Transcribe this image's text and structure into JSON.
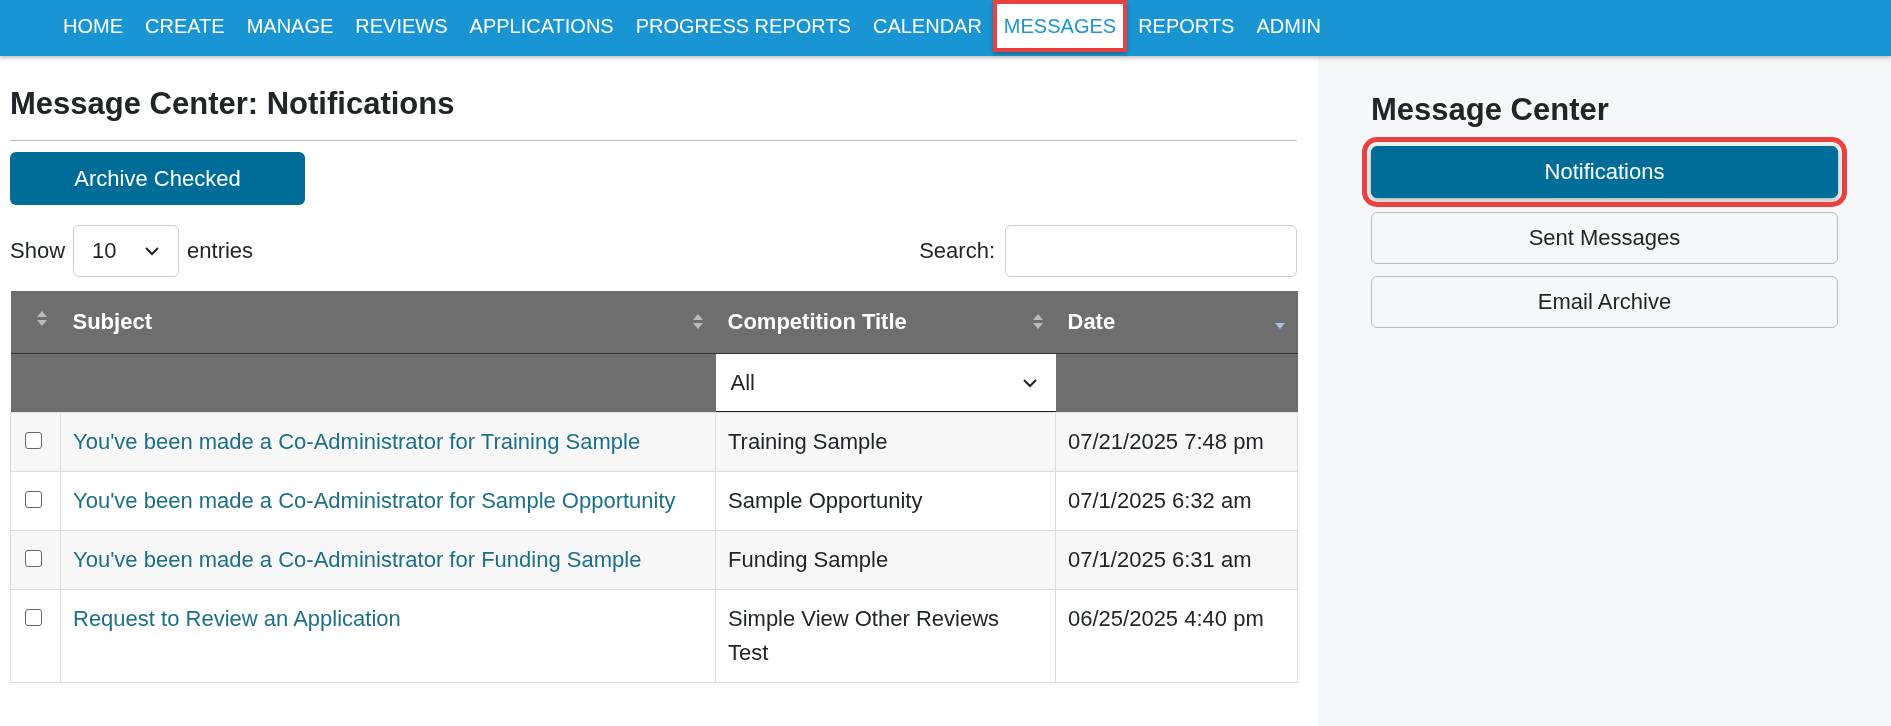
{
  "nav": {
    "items": [
      {
        "label": "HOME",
        "selected": false,
        "highlighted": false
      },
      {
        "label": "CREATE",
        "selected": false,
        "highlighted": false
      },
      {
        "label": "MANAGE",
        "selected": false,
        "highlighted": false
      },
      {
        "label": "REVIEWS",
        "selected": false,
        "highlighted": false
      },
      {
        "label": "APPLICATIONS",
        "selected": false,
        "highlighted": false
      },
      {
        "label": "PROGRESS REPORTS",
        "selected": false,
        "highlighted": false
      },
      {
        "label": "CALENDAR",
        "selected": false,
        "highlighted": false
      },
      {
        "label": "MESSAGES",
        "selected": true,
        "highlighted": true
      },
      {
        "label": "REPORTS",
        "selected": false,
        "highlighted": false
      },
      {
        "label": "ADMIN",
        "selected": false,
        "highlighted": false
      }
    ]
  },
  "main": {
    "title": "Message Center: Notifications",
    "archive_button": "Archive Checked",
    "length": {
      "prefix": "Show",
      "value": "10",
      "suffix": "entries"
    },
    "search": {
      "label": "Search:"
    },
    "table": {
      "select_column": {
        "sorted": false
      },
      "columns": [
        {
          "label": "Subject",
          "sorted": false
        },
        {
          "label": "Competition Title",
          "sorted": false
        },
        {
          "label": "Date",
          "sorted": true
        }
      ],
      "competition_filter": {
        "value": "All"
      },
      "rows": [
        {
          "checked": false,
          "subject": "You've been made a Co-Administrator for Training Sample",
          "competition": "Training Sample",
          "date": "07/21/2025 7:48 pm"
        },
        {
          "checked": false,
          "subject": "You've been made a Co-Administrator for Sample Opportunity",
          "competition": "Sample Opportunity",
          "date": "07/1/2025 6:32 am"
        },
        {
          "checked": false,
          "subject": "You've been made a Co-Administrator for Funding Sample",
          "competition": "Funding Sample",
          "date": "07/1/2025 6:31 am"
        },
        {
          "checked": false,
          "subject": "Request to Review an Application",
          "competition": "Simple View Other Reviews Test",
          "date": "06/25/2025 4:40 pm"
        }
      ]
    }
  },
  "sidebar": {
    "title": "Message Center",
    "buttons": [
      {
        "label": "Notifications",
        "selected": true,
        "highlighted": true
      },
      {
        "label": "Sent Messages",
        "selected": false,
        "highlighted": false
      },
      {
        "label": "Email Archive",
        "selected": false,
        "highlighted": false
      }
    ]
  }
}
